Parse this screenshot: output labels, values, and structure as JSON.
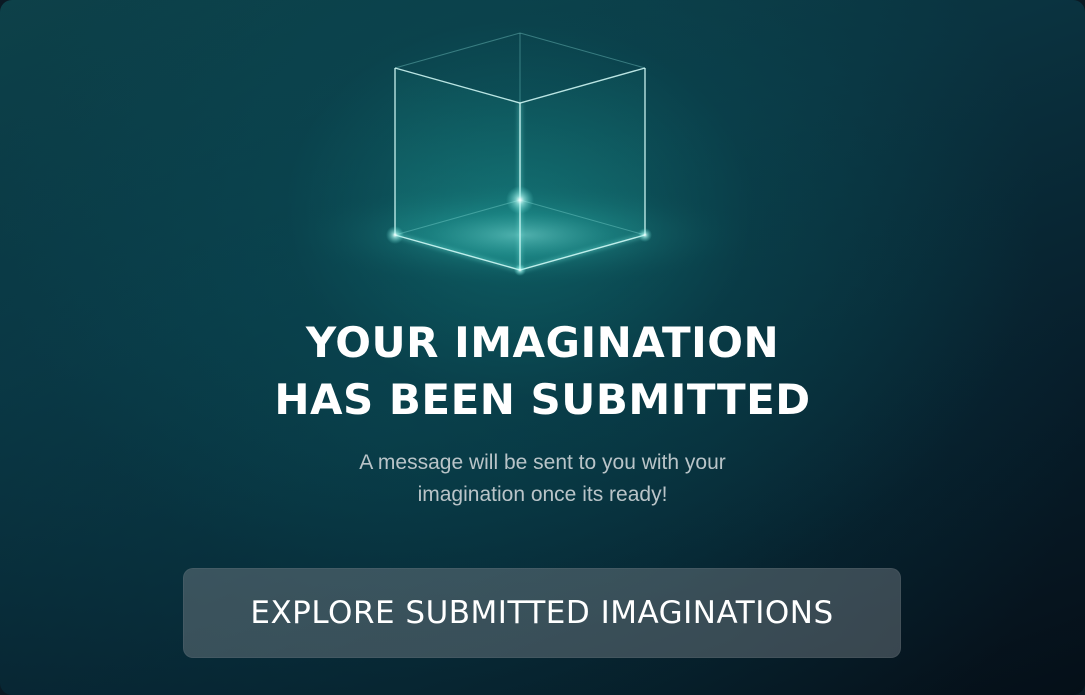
{
  "illustration": {
    "icon": "glowing-cube-icon"
  },
  "confirmation": {
    "title_line1": "YOUR IMAGINATION",
    "title_line2": "HAS BEEN SUBMITTED",
    "message_line1": "A message will be sent to you with your",
    "message_line2": "imagination once its ready!"
  },
  "actions": {
    "explore_label": "EXPLORE SUBMITTED IMAGINATIONS"
  },
  "colors": {
    "background_top": "#0d4149",
    "background_bottom": "#050f18",
    "title_text": "#ffffff",
    "message_text": "#b9c4c8",
    "button_background": "#60686f"
  }
}
